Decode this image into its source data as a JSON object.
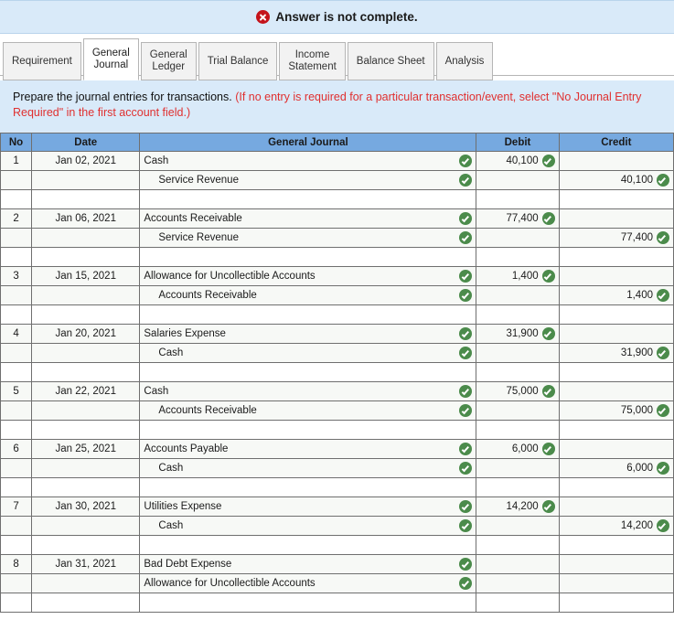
{
  "banner": {
    "icon": "error-x-icon",
    "text": "Answer is not complete."
  },
  "tabs": [
    {
      "label": "Requirement",
      "active": false
    },
    {
      "label": "General\nJournal",
      "active": true
    },
    {
      "label": "General\nLedger",
      "active": false
    },
    {
      "label": "Trial Balance",
      "active": false
    },
    {
      "label": "Income\nStatement",
      "active": false
    },
    {
      "label": "Balance Sheet",
      "active": false
    },
    {
      "label": "Analysis",
      "active": false
    }
  ],
  "instructions": {
    "black": "Prepare the journal entries for transactions. ",
    "red": "(If no entry is required for a particular transaction/event, select \"No Journal Entry Required\" in the first account field.)"
  },
  "table": {
    "headers": [
      "No",
      "Date",
      "General Journal",
      "Debit",
      "Credit"
    ],
    "rows": [
      {
        "type": "filled",
        "no": "1",
        "date": "Jan 02, 2021",
        "account": "Cash",
        "indent": false,
        "acct_check": true,
        "debit": "40,100",
        "debit_check": true,
        "credit": "",
        "credit_check": false
      },
      {
        "type": "filled",
        "no": "",
        "date": "",
        "account": "Service Revenue",
        "indent": true,
        "acct_check": true,
        "debit": "",
        "debit_check": false,
        "credit": "40,100",
        "credit_check": true
      },
      {
        "type": "blank",
        "no": "",
        "date": "",
        "account": "",
        "indent": false,
        "acct_check": false,
        "debit": "",
        "debit_check": false,
        "credit": "",
        "credit_check": false
      },
      {
        "type": "filled",
        "no": "2",
        "date": "Jan 06, 2021",
        "account": "Accounts Receivable",
        "indent": false,
        "acct_check": true,
        "debit": "77,400",
        "debit_check": true,
        "credit": "",
        "credit_check": false
      },
      {
        "type": "filled",
        "no": "",
        "date": "",
        "account": "Service Revenue",
        "indent": true,
        "acct_check": true,
        "debit": "",
        "debit_check": false,
        "credit": "77,400",
        "credit_check": true
      },
      {
        "type": "blank",
        "no": "",
        "date": "",
        "account": "",
        "indent": false,
        "acct_check": false,
        "debit": "",
        "debit_check": false,
        "credit": "",
        "credit_check": false
      },
      {
        "type": "filled",
        "no": "3",
        "date": "Jan 15, 2021",
        "account": "Allowance for Uncollectible Accounts",
        "indent": false,
        "acct_check": true,
        "debit": "1,400",
        "debit_check": true,
        "credit": "",
        "credit_check": false
      },
      {
        "type": "filled",
        "no": "",
        "date": "",
        "account": "Accounts Receivable",
        "indent": true,
        "acct_check": true,
        "debit": "",
        "debit_check": false,
        "credit": "1,400",
        "credit_check": true
      },
      {
        "type": "blank",
        "no": "",
        "date": "",
        "account": "",
        "indent": false,
        "acct_check": false,
        "debit": "",
        "debit_check": false,
        "credit": "",
        "credit_check": false
      },
      {
        "type": "filled",
        "no": "4",
        "date": "Jan 20, 2021",
        "account": "Salaries Expense",
        "indent": false,
        "acct_check": true,
        "debit": "31,900",
        "debit_check": true,
        "credit": "",
        "credit_check": false
      },
      {
        "type": "filled",
        "no": "",
        "date": "",
        "account": "Cash",
        "indent": true,
        "acct_check": true,
        "debit": "",
        "debit_check": false,
        "credit": "31,900",
        "credit_check": true
      },
      {
        "type": "blank",
        "no": "",
        "date": "",
        "account": "",
        "indent": false,
        "acct_check": false,
        "debit": "",
        "debit_check": false,
        "credit": "",
        "credit_check": false
      },
      {
        "type": "filled",
        "no": "5",
        "date": "Jan 22, 2021",
        "account": "Cash",
        "indent": false,
        "acct_check": true,
        "debit": "75,000",
        "debit_check": true,
        "credit": "",
        "credit_check": false
      },
      {
        "type": "filled",
        "no": "",
        "date": "",
        "account": "Accounts Receivable",
        "indent": true,
        "acct_check": true,
        "debit": "",
        "debit_check": false,
        "credit": "75,000",
        "credit_check": true
      },
      {
        "type": "blank",
        "no": "",
        "date": "",
        "account": "",
        "indent": false,
        "acct_check": false,
        "debit": "",
        "debit_check": false,
        "credit": "",
        "credit_check": false
      },
      {
        "type": "filled",
        "no": "6",
        "date": "Jan 25, 2021",
        "account": "Accounts Payable",
        "indent": false,
        "acct_check": true,
        "debit": "6,000",
        "debit_check": true,
        "credit": "",
        "credit_check": false
      },
      {
        "type": "filled",
        "no": "",
        "date": "",
        "account": "Cash",
        "indent": true,
        "acct_check": true,
        "debit": "",
        "debit_check": false,
        "credit": "6,000",
        "credit_check": true
      },
      {
        "type": "blank",
        "no": "",
        "date": "",
        "account": "",
        "indent": false,
        "acct_check": false,
        "debit": "",
        "debit_check": false,
        "credit": "",
        "credit_check": false
      },
      {
        "type": "filled",
        "no": "7",
        "date": "Jan 30, 2021",
        "account": "Utilities Expense",
        "indent": false,
        "acct_check": true,
        "debit": "14,200",
        "debit_check": true,
        "credit": "",
        "credit_check": false
      },
      {
        "type": "filled",
        "no": "",
        "date": "",
        "account": "Cash",
        "indent": true,
        "acct_check": true,
        "debit": "",
        "debit_check": false,
        "credit": "14,200",
        "credit_check": true
      },
      {
        "type": "blank",
        "no": "",
        "date": "",
        "account": "",
        "indent": false,
        "acct_check": false,
        "debit": "",
        "debit_check": false,
        "credit": "",
        "credit_check": false
      },
      {
        "type": "filled",
        "no": "8",
        "date": "Jan 31, 2021",
        "account": "Bad Debt Expense",
        "indent": false,
        "acct_check": true,
        "debit": "",
        "debit_check": false,
        "credit": "",
        "credit_check": false
      },
      {
        "type": "filled",
        "no": "",
        "date": "",
        "account": "Allowance for Uncollectible Accounts",
        "indent": false,
        "acct_check": true,
        "debit": "",
        "debit_check": false,
        "credit": "",
        "credit_check": false
      },
      {
        "type": "blank",
        "no": "",
        "date": "",
        "account": "",
        "indent": false,
        "acct_check": false,
        "debit": "",
        "debit_check": false,
        "credit": "",
        "credit_check": false
      }
    ]
  },
  "colors": {
    "header_blue": "#76a9e0",
    "banner_blue": "#d9eaf9",
    "check_green": "#4b8b4b",
    "error_red": "#c4131b",
    "instruction_red": "#e03030",
    "row_fill": "#f7f9f6"
  }
}
